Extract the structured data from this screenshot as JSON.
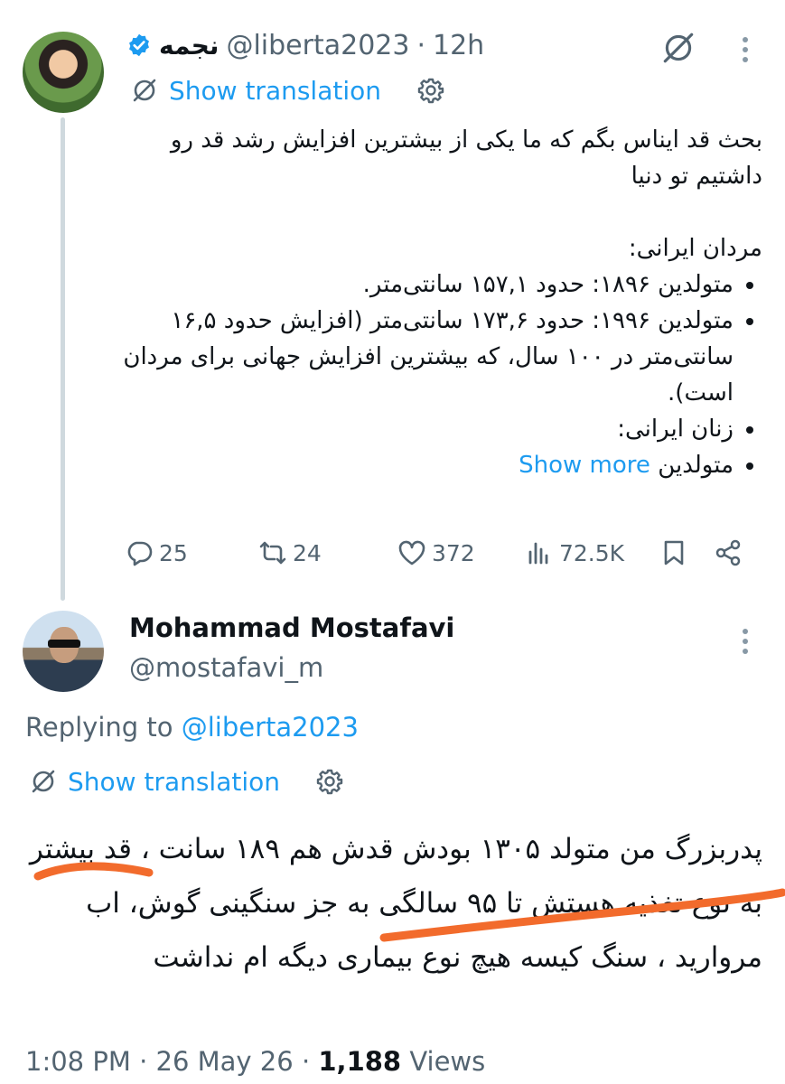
{
  "tweet1": {
    "display_name": "نجمه",
    "handle": "@liberta2023",
    "separator": "·",
    "time": "12h",
    "show_translation": "Show translation",
    "body_intro": "بحث قد ایناس بگم که ما یکی از بیشترین افزایش رشد قد رو داشتیم تو دنیا",
    "section_men": "مردان ایرانی:",
    "bullet_1": "متولدین ۱۸۹۶: حدود ۱۵۷,۱ سانتی‌متر.",
    "bullet_2": "متولدین ۱۹۹۶: حدود ۱۷۳,۶ سانتی‌متر (افزایش حدود ۱۶,۵ سانتی‌متر در ۱۰۰ سال، که بیشترین افزایش جهانی برای مردان است).",
    "bullet_3": "زنان ایرانی:",
    "bullet_4": "متولدین",
    "show_more": "Show more",
    "replies": "25",
    "retweets": "24",
    "likes": "372",
    "views": "72.5K",
    "icons": [
      "verified-badge-icon",
      "mute-icon",
      "more-icon",
      "translate-icon",
      "gear-icon",
      "reply-icon",
      "retweet-icon",
      "like-icon",
      "views-icon",
      "bookmark-icon",
      "share-icon"
    ]
  },
  "tweet2": {
    "display_name": "Mohammad Mostafavi",
    "handle": "@mostafavi_m",
    "replying_prefix": "Replying to",
    "replying_handle": "@liberta2023",
    "show_translation": "Show translation",
    "body": "پدربزرگ من متولد ۱۳۰۵ بودش قدش هم ۱۸۹ سانت ، قد بیشتر به نوع تغذیه هستش تا ۹۵ سالگی به جز سنگینی گوش، اب مروارید ، سنگ کیسه هیچ نوع بیماری دیگه ام نداشت",
    "time": "1:08 PM",
    "separator_1": "·",
    "date": "26 May 26",
    "separator_2": "·",
    "views_count": "1,188",
    "views_label": "Views"
  },
  "colors": {
    "accent": "#1d9bf0",
    "secondary_text": "#536471",
    "primary_text": "#0f1419",
    "annotation_stroke": "#f26b2c"
  }
}
